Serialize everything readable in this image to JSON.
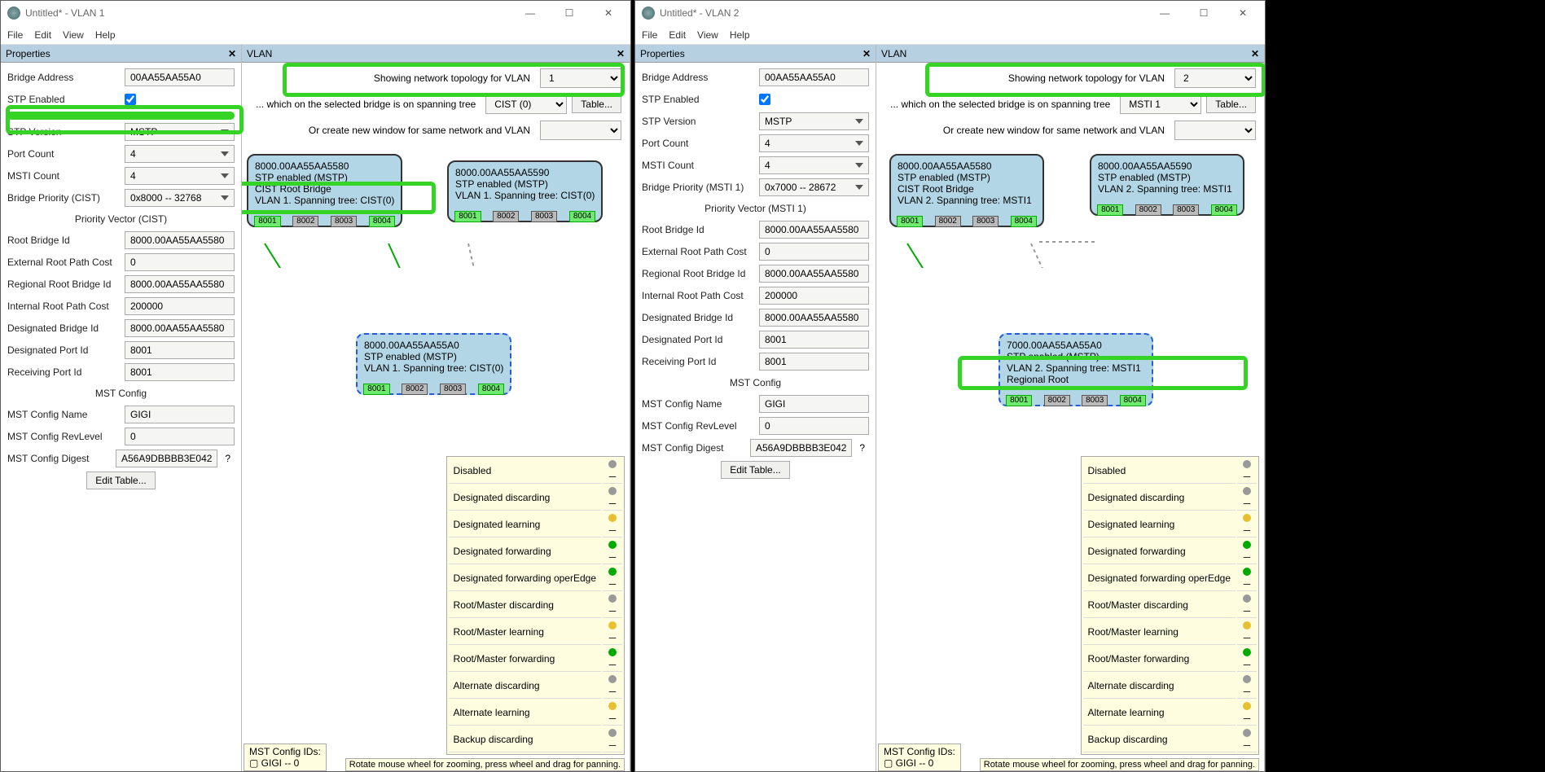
{
  "windows": [
    {
      "title": "Untitled* - VLAN 1",
      "menubar": [
        "File",
        "Edit",
        "View",
        "Help"
      ],
      "properties_title": "Properties",
      "vlan_title": "VLAN",
      "props": {
        "bridge_address_label": "Bridge Address",
        "bridge_address": "00AA55AA55A0",
        "stp_enabled_label": "STP Enabled",
        "stp_enabled": true,
        "stp_version_label": "STP Version",
        "stp_version": "MSTP",
        "port_count_label": "Port Count",
        "port_count": "4",
        "msti_count_label": "MSTI Count",
        "msti_count": "4",
        "bridge_prio_label": "Bridge Priority (CIST)",
        "bridge_prio": "0x8000 -- 32768",
        "pv_title": "Priority Vector (CIST)",
        "root_bridge_id_label": "Root Bridge Id",
        "root_bridge_id": "8000.00AA55AA5580",
        "ext_cost_label": "External Root Path Cost",
        "ext_cost": "0",
        "reg_root_label": "Regional Root Bridge Id",
        "reg_root": "8000.00AA55AA5580",
        "int_cost_label": "Internal Root Path Cost",
        "int_cost": "200000",
        "desig_bridge_label": "Designated Bridge Id",
        "desig_bridge": "8000.00AA55AA5580",
        "desig_port_label": "Designated Port Id",
        "desig_port": "8001",
        "recv_port_label": "Receiving Port Id",
        "recv_port": "8001",
        "mst_title": "MST Config",
        "mst_name_label": "MST Config Name",
        "mst_name": "GIGI",
        "mst_rev_label": "MST Config RevLevel",
        "mst_rev": "0",
        "mst_digest_label": "MST Config Digest",
        "mst_digest": "A56A9DBBBB3E042",
        "edit_table": "Edit Table..."
      },
      "vlan": {
        "topology_label": "Showing network topology for VLAN",
        "topology_val": "1",
        "spanning_label": "... which on the selected bridge is on spanning tree",
        "spanning_val": "CIST (0)",
        "table_btn": "Table...",
        "newwin_label": "Or create new window for same network and VLAN"
      },
      "nodes": {
        "n1": {
          "id": "8000.00AA55AA5580",
          "stp": "STP enabled (MSTP)",
          "role": "CIST Root Bridge",
          "span": "VLAN 1. Spanning tree: CIST(0)"
        },
        "n2": {
          "id": "8000.00AA55AA5590",
          "stp": "STP enabled (MSTP)",
          "span": "VLAN 1. Spanning tree: CIST(0)"
        },
        "n3": {
          "id": "8000.00AA55AA55A0",
          "stp": "STP enabled (MSTP)",
          "span": "VLAN 1. Spanning tree: CIST(0)"
        }
      },
      "ports": [
        "8001",
        "8002",
        "8003",
        "8004"
      ],
      "mst_ids_title": "MST Config IDs:",
      "mst_ids_item": "GIGI -- 0",
      "statusbar": "Rotate mouse wheel for zooming, press wheel and drag for panning."
    },
    {
      "title": "Untitled* - VLAN 2",
      "menubar": [
        "File",
        "Edit",
        "View",
        "Help"
      ],
      "properties_title": "Properties",
      "vlan_title": "VLAN",
      "props": {
        "bridge_address_label": "Bridge Address",
        "bridge_address": "00AA55AA55A0",
        "stp_enabled_label": "STP Enabled",
        "stp_enabled": true,
        "stp_version_label": "STP Version",
        "stp_version": "MSTP",
        "port_count_label": "Port Count",
        "port_count": "4",
        "msti_count_label": "MSTI Count",
        "msti_count": "4",
        "bridge_prio_label": "Bridge Priority (MSTI 1)",
        "bridge_prio": "0x7000 -- 28672",
        "pv_title": "Priority Vector (MSTI 1)",
        "root_bridge_id_label": "Root Bridge Id",
        "root_bridge_id": "8000.00AA55AA5580",
        "ext_cost_label": "External Root Path Cost",
        "ext_cost": "0",
        "reg_root_label": "Regional Root Bridge Id",
        "reg_root": "8000.00AA55AA5580",
        "int_cost_label": "Internal Root Path Cost",
        "int_cost": "200000",
        "desig_bridge_label": "Designated Bridge Id",
        "desig_bridge": "8000.00AA55AA5580",
        "desig_port_label": "Designated Port Id",
        "desig_port": "8001",
        "recv_port_label": "Receiving Port Id",
        "recv_port": "8001",
        "mst_title": "MST Config",
        "mst_name_label": "MST Config Name",
        "mst_name": "GIGI",
        "mst_rev_label": "MST Config RevLevel",
        "mst_rev": "0",
        "mst_digest_label": "MST Config Digest",
        "mst_digest": "A56A9DBBBB3E042",
        "edit_table": "Edit Table..."
      },
      "vlan": {
        "topology_label": "Showing network topology for VLAN",
        "topology_val": "2",
        "spanning_label": "... which on the selected bridge is on spanning tree",
        "spanning_val": "MSTI 1",
        "table_btn": "Table...",
        "newwin_label": "Or create new window for same network and VLAN"
      },
      "nodes": {
        "n1": {
          "id": "8000.00AA55AA5580",
          "stp": "STP enabled (MSTP)",
          "role": "CIST Root Bridge",
          "span": "VLAN 2. Spanning tree: MSTI1"
        },
        "n2": {
          "id": "8000.00AA55AA5590",
          "stp": "STP enabled (MSTP)",
          "span": "VLAN 2. Spanning tree: MSTI1"
        },
        "n3": {
          "id": "7000.00AA55AA55A0",
          "stp": "STP enabled (MSTP)",
          "span": "VLAN 2. Spanning tree: MSTI1",
          "role": "Regional Root"
        }
      },
      "ports": [
        "8001",
        "8002",
        "8003",
        "8004"
      ],
      "mst_ids_title": "MST Config IDs:",
      "mst_ids_item": "GIGI -- 0",
      "statusbar": "Rotate mouse wheel for zooming, press wheel and drag for panning."
    }
  ],
  "legend": [
    "Disabled",
    "Designated discarding",
    "Designated learning",
    "Designated forwarding",
    "Designated forwarding operEdge",
    "Root/Master discarding",
    "Root/Master learning",
    "Root/Master forwarding",
    "Alternate discarding",
    "Alternate learning",
    "Backup discarding"
  ],
  "legend_colors": [
    "#999",
    "#999",
    "#e6c030",
    "#0a0",
    "#0a0",
    "#999",
    "#e6c030",
    "#0a0",
    "#999",
    "#e6c030",
    "#999"
  ]
}
